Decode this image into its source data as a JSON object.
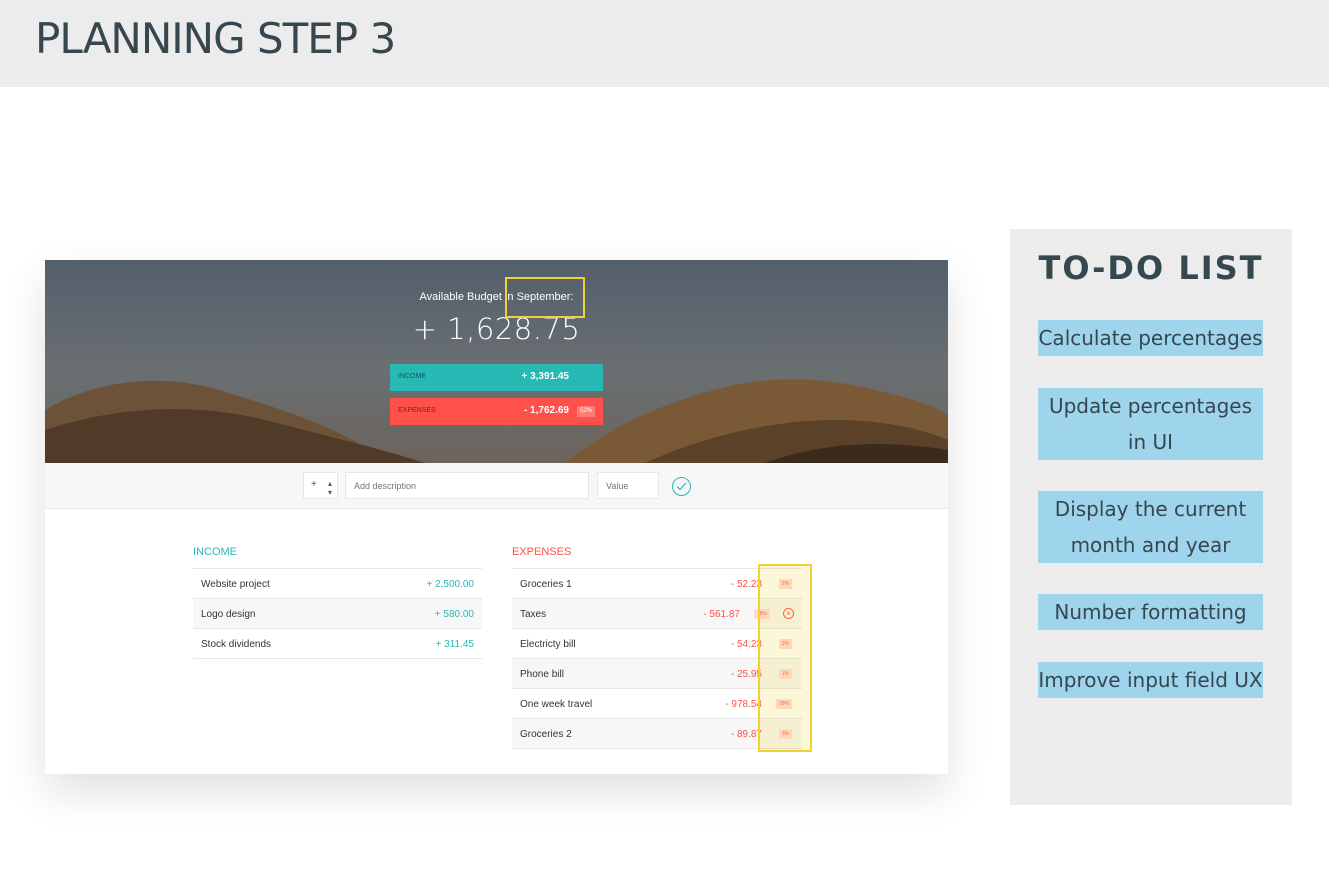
{
  "header": {
    "title": "PLANNING STEP 3"
  },
  "app": {
    "budget_title": "Available Budget in September:",
    "budget_value": "+ 1,628.75",
    "income_label": "INCOME",
    "income_value": "+ 3,391.45",
    "expenses_label": "EXPENSES",
    "expenses_value": "- 1,762.69",
    "expenses_percentage": "52%",
    "add_type": "+",
    "add_description_placeholder": "Add description",
    "add_value_placeholder": "Value",
    "income_title": "INCOME",
    "expenses_title": "EXPENSES",
    "income_items": [
      {
        "description": "Website project",
        "value": "+ 2,500.00"
      },
      {
        "description": "Logo design",
        "value": "+ 580.00"
      },
      {
        "description": "Stock dividends",
        "value": "+ 311.45"
      }
    ],
    "expense_items": [
      {
        "description": "Groceries 1",
        "value": "- 52.23",
        "percentage": "2%"
      },
      {
        "description": "Taxes",
        "value": "- 561.87",
        "percentage": "18%"
      },
      {
        "description": "Electricty bill",
        "value": "- 54.23",
        "percentage": "2%"
      },
      {
        "description": "Phone bill",
        "value": "- 25.95",
        "percentage": "1%"
      },
      {
        "description": "One week travel",
        "value": "- 978.54",
        "percentage": "29%"
      },
      {
        "description": "Groceries 2",
        "value": "- 89.87",
        "percentage": "3%"
      }
    ],
    "colors": {
      "income": "#28b9b5",
      "expenses": "#ff5049",
      "highlight": "#f2d22e"
    }
  },
  "todo": {
    "title": "TO-DO LIST",
    "items": [
      "Calculate percentages",
      "Update percentages in UI",
      "Display the current month and year",
      "Number formatting",
      "Improve input field UX"
    ],
    "color": "#9ed4ec"
  }
}
